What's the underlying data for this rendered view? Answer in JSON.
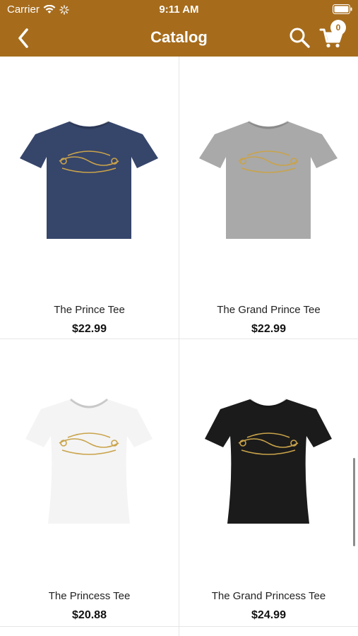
{
  "status": {
    "carrier": "Carrier",
    "time": "9:11 AM"
  },
  "nav": {
    "title": "Catalog",
    "cart_count": "0"
  },
  "colors": {
    "header": "#a66c1c",
    "text": "#222222"
  },
  "products": [
    {
      "name": "The Prince Tee",
      "price": "$22.99",
      "shirt_color": "#36456a",
      "style": "crew"
    },
    {
      "name": "The Grand Prince Tee",
      "price": "$22.99",
      "shirt_color": "#a9a9a9",
      "style": "crew"
    },
    {
      "name": "The Princess Tee",
      "price": "$20.88",
      "shirt_color": "#f4f4f4",
      "style": "fitted"
    },
    {
      "name": "The Grand Princess Tee",
      "price": "$24.99",
      "shirt_color": "#1b1b1b",
      "style": "fitted"
    }
  ]
}
